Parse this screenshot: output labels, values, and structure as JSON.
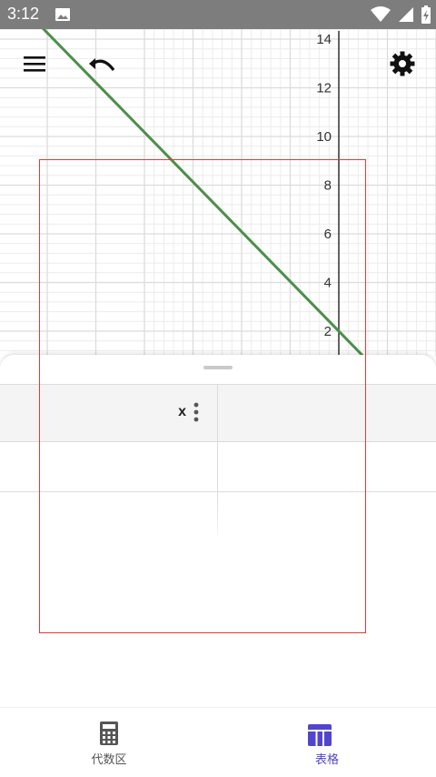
{
  "status_bar": {
    "time": "3:12",
    "icons": [
      "image-icon",
      "wifi-icon",
      "cell-signal-icon",
      "battery-charging-icon"
    ]
  },
  "toolbar": {
    "menu_icon": "menu-icon",
    "undo_icon": "undo-icon",
    "settings_icon": "gear-icon"
  },
  "graph": {
    "y_ticks": [
      "14",
      "12",
      "10",
      "8",
      "6",
      "4",
      "2"
    ],
    "line_color": "#4d8f4a",
    "grid_color": "#dcdcdc"
  },
  "table": {
    "column_header": "x",
    "column_menu_icon": "more-vertical-icon"
  },
  "bottom_nav": {
    "items": [
      {
        "label": "代数区",
        "icon": "calculator-icon"
      },
      {
        "label": "表格",
        "icon": "table-icon"
      }
    ],
    "active_color": "#5145cd"
  }
}
